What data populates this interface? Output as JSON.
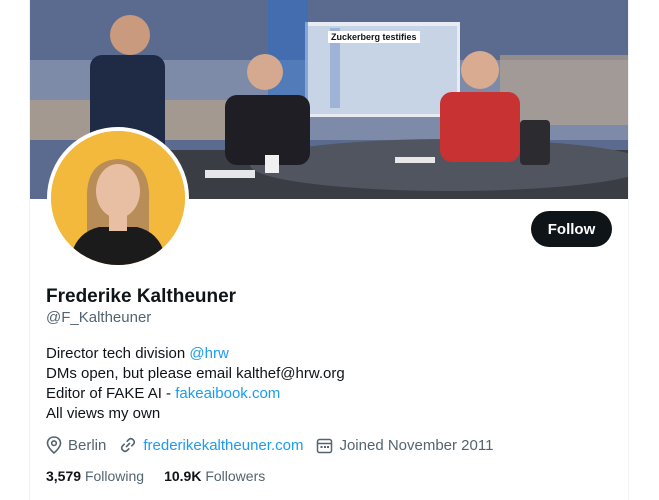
{
  "banner": {
    "screen_text": "Zuckerberg testifies"
  },
  "follow_button": {
    "label": "Follow"
  },
  "profile": {
    "name": "Frederike Kaltheuner",
    "handle": "@F_Kaltheuner",
    "bio": {
      "line1_text": "Director tech division ",
      "line1_mention": "@hrw",
      "line2": "DMs open, but please email kalthef@hrw.org",
      "line3_text": "Editor of FAKE AI - ",
      "line3_link": "fakeaibook.com",
      "line4": "All views my own"
    },
    "location": "Berlin",
    "website": "frederikekaltheuner.com",
    "joined": "Joined November 2011"
  },
  "stats": {
    "following_count": "3,579",
    "following_label": "Following",
    "followers_count": "10.9K",
    "followers_label": "Followers"
  },
  "colors": {
    "link": "#1d9bf0",
    "secondary_text": "#536471",
    "button_bg": "#0f1419",
    "avatar_bg": "#f3b93d"
  }
}
